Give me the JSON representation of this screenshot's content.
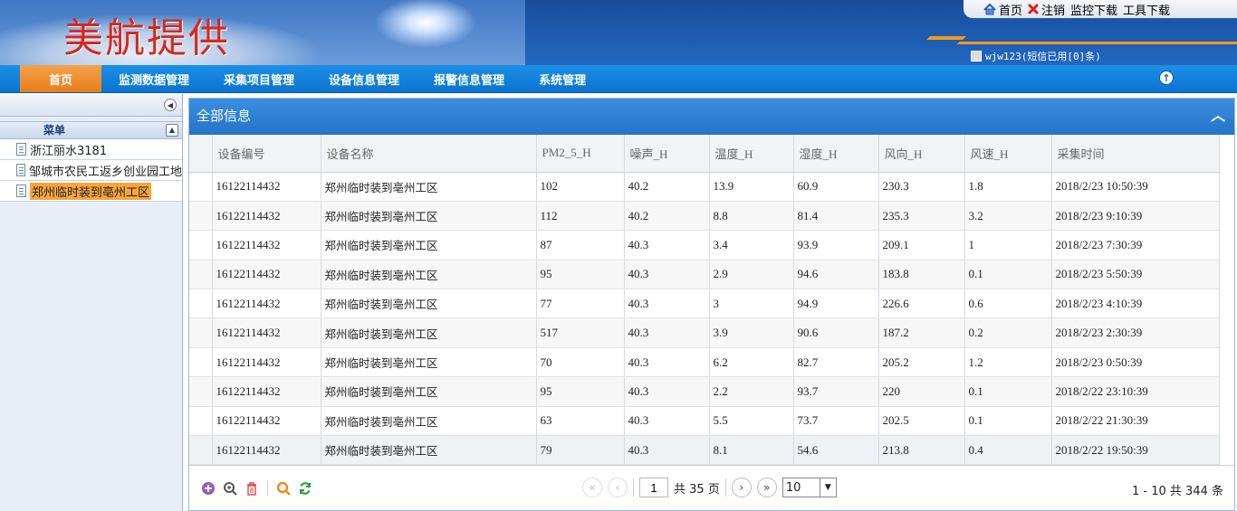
{
  "header": {
    "logo_text": "美航提供",
    "links": [
      {
        "icon": "home-icon",
        "label": "首页"
      },
      {
        "icon": "logout-icon",
        "label": "注销"
      },
      {
        "icon": "",
        "label": "监控下载"
      },
      {
        "icon": "",
        "label": "工具下载"
      }
    ],
    "user_text": "wjw123(短信已用[0]条)"
  },
  "nav": {
    "items": [
      "首页",
      "监测数据管理",
      "采集项目管理",
      "设备信息管理",
      "报警信息管理",
      "系统管理"
    ],
    "active_index": 0
  },
  "sidebar": {
    "menu_title": "菜单",
    "items": [
      "浙江丽水3181",
      "邹城市农民工返乡创业园工地",
      "郑州临时装到亳州工区"
    ],
    "selected_index": 2
  },
  "panel": {
    "title": "全部信息",
    "columns": [
      "设备编号",
      "设备名称",
      "PM2_5_H",
      "噪声_H",
      "温度_H",
      "湿度_H",
      "风向_H",
      "风速_H",
      "采集时间"
    ],
    "rows": [
      [
        "16122114432",
        "郑州临时装到亳州工区",
        "102",
        "40.2",
        "13.9",
        "60.9",
        "230.3",
        "1.8",
        "2018/2/23 10:50:39"
      ],
      [
        "16122114432",
        "郑州临时装到亳州工区",
        "112",
        "40.2",
        "8.8",
        "81.4",
        "235.3",
        "3.2",
        "2018/2/23 9:10:39"
      ],
      [
        "16122114432",
        "郑州临时装到亳州工区",
        "87",
        "40.3",
        "3.4",
        "93.9",
        "209.1",
        "1",
        "2018/2/23 7:30:39"
      ],
      [
        "16122114432",
        "郑州临时装到亳州工区",
        "95",
        "40.3",
        "2.9",
        "94.6",
        "183.8",
        "0.1",
        "2018/2/23 5:50:39"
      ],
      [
        "16122114432",
        "郑州临时装到亳州工区",
        "77",
        "40.3",
        "3",
        "94.9",
        "226.6",
        "0.6",
        "2018/2/23 4:10:39"
      ],
      [
        "16122114432",
        "郑州临时装到亳州工区",
        "517",
        "40.3",
        "3.9",
        "90.6",
        "187.2",
        "0.2",
        "2018/2/23 2:30:39"
      ],
      [
        "16122114432",
        "郑州临时装到亳州工区",
        "70",
        "40.3",
        "6.2",
        "82.7",
        "205.2",
        "1.2",
        "2018/2/23 0:50:39"
      ],
      [
        "16122114432",
        "郑州临时装到亳州工区",
        "95",
        "40.3",
        "2.2",
        "93.7",
        "220",
        "0.1",
        "2018/2/22 23:10:39"
      ],
      [
        "16122114432",
        "郑州临时装到亳州工区",
        "63",
        "40.3",
        "5.5",
        "73.7",
        "202.5",
        "0.1",
        "2018/2/22 21:30:39"
      ],
      [
        "16122114432",
        "郑州临时装到亳州工区",
        "79",
        "40.3",
        "8.1",
        "54.6",
        "213.8",
        "0.4",
        "2018/2/22 19:50:39"
      ]
    ]
  },
  "pager": {
    "page": "1",
    "total_pages_text": "共 35 页",
    "page_size": "10",
    "info_text": "1 - 10   共 344 条"
  },
  "colors": {
    "nav_blue": "#0a73cf",
    "nav_active": "#e87d1c",
    "panel_title": "#2474c9",
    "selected_node": "#f7a53a",
    "logo_red": "#d7281c"
  }
}
